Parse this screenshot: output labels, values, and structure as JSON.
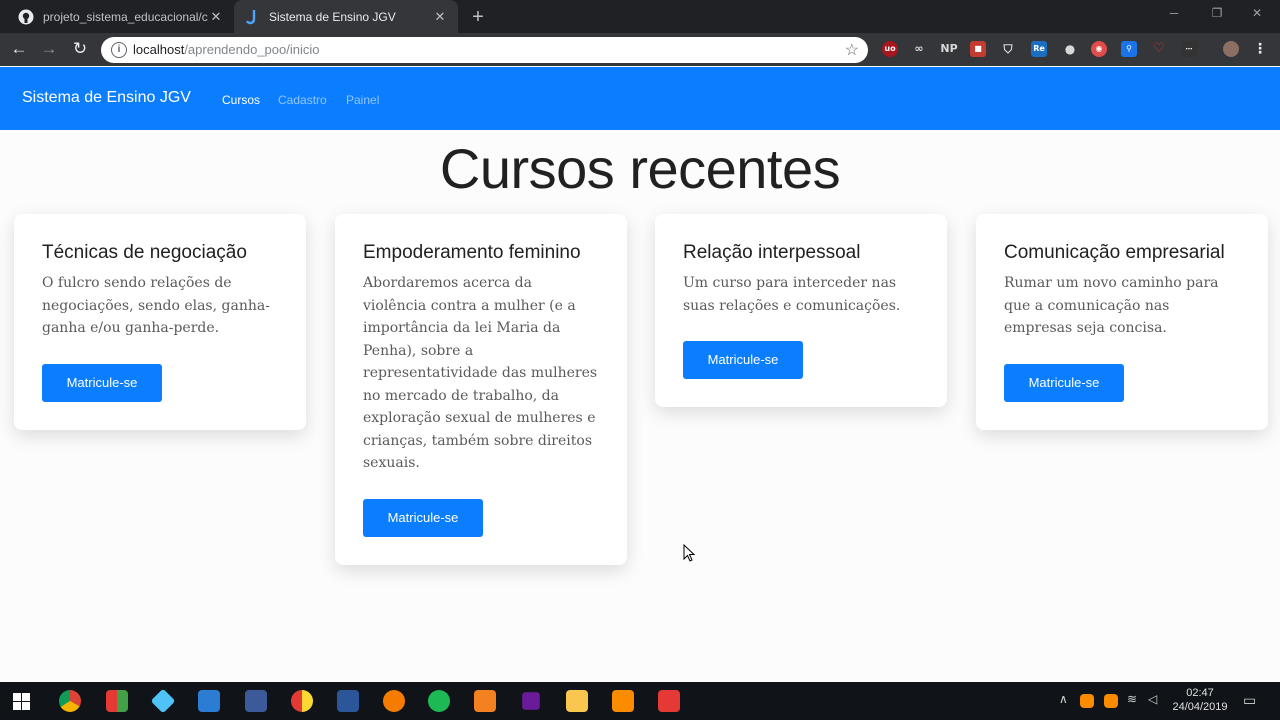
{
  "browser": {
    "tabs": [
      {
        "title": "projeto_sistema_educacional/co",
        "icon": "github-icon",
        "active": false
      },
      {
        "title": "Sistema de Ensino JGV",
        "icon": "page-icon",
        "active": true
      }
    ],
    "new_tab_label": "+",
    "address": {
      "host": "localhost",
      "path": "/aprendendo_poo/inicio"
    }
  },
  "site": {
    "brand": "Sistema de Ensino JGV",
    "nav": [
      "Cursos",
      "Cadastro",
      "Painel"
    ],
    "active_nav": "Cursos",
    "accent_color": "#0b7dff"
  },
  "page": {
    "heading": "Cursos recentes",
    "courses": [
      {
        "title": "Técnicas de negociação",
        "description": "O fulcro sendo relações de negociações, sendo elas, ganha-ganha e/ou ganha-perde.",
        "button": "Matricule-se"
      },
      {
        "title": "Empoderamento feminino",
        "description": "Abordaremos acerca da violência contra a mulher (e a importância da lei Maria da Penha), sobre a representatividade das mulheres no mercado de trabalho, da exploração sexual de mulheres e crianças, também sobre direitos sexuais.",
        "button": "Matricule-se"
      },
      {
        "title": "Relação interpessoal",
        "description": "Um curso para interceder nas suas relações e comunicações.",
        "button": "Matricule-se"
      },
      {
        "title": "Comunicação empresarial",
        "description": "Rumar um novo caminho para que a comunicação nas empresas seja concisa.",
        "button": "Matricule-se"
      }
    ]
  },
  "taskbar": {
    "time": "02:47",
    "date": "24/04/2019"
  }
}
